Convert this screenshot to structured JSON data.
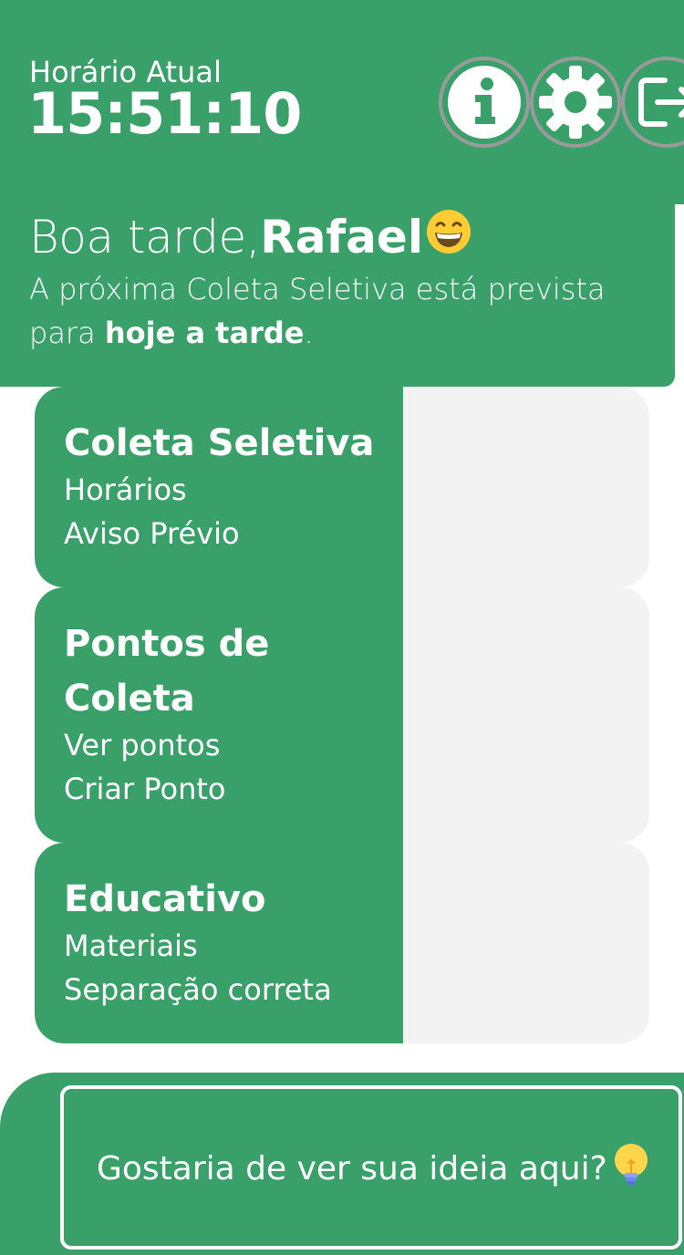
{
  "header": {
    "time_label": "Horário Atual",
    "time_value": "15:51:10",
    "icons": [
      "info-icon",
      "gear-icon",
      "logout-icon"
    ]
  },
  "greeting": {
    "prefix": "Boa tarde,",
    "name": "Rafael",
    "emoji": "grinning-face-emoji",
    "next_line_1": "A próxima Coleta Seletiva está prevista",
    "next_line_2_prefix": "para ",
    "next_line_2_bold": "hoje a tarde",
    "next_line_2_suffix": "."
  },
  "cards": [
    {
      "title": "Coleta Seletiva",
      "links": [
        "Horários",
        "Aviso Prévio"
      ]
    },
    {
      "title": "Pontos de Coleta",
      "links": [
        "Ver pontos",
        "Criar Ponto"
      ]
    },
    {
      "title": "Educativo",
      "links": [
        "Materiais",
        "Separação correta"
      ]
    }
  ],
  "idea": {
    "text": "Gostaria de ver sua ideia aqui?",
    "icon": "lightbulb-icon"
  },
  "colors": {
    "primary_green": "#3aa06a",
    "card_background": "#f3f3f3",
    "icon_ring": "#9a9a9a",
    "white": "#ffffff"
  }
}
